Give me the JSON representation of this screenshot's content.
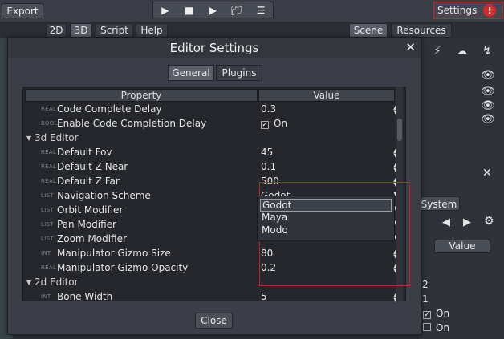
{
  "topbar": {
    "export_label": "Export",
    "settings_label": "Settings",
    "warning_glyph": "!"
  },
  "view_tabs": [
    "2D",
    "3D",
    "Script",
    "Help"
  ],
  "dock_tabs": [
    "Scene",
    "Resources"
  ],
  "right_panel": {
    "system_tab": "System",
    "value_header": "Value",
    "values": [
      "2",
      "1"
    ],
    "checks": [
      "On",
      "On"
    ]
  },
  "dialog": {
    "title": "Editor Settings",
    "tabs": [
      "General",
      "Plugins"
    ],
    "columns": {
      "property": "Property",
      "value": "Value"
    },
    "rows": [
      {
        "kind": "prop",
        "type": "REAL",
        "label": "Code Complete Delay",
        "value": "0.3",
        "control": "spin"
      },
      {
        "kind": "prop",
        "type": "BOOL",
        "label": "Enable Code Completion Delay",
        "value": "On",
        "control": "check"
      },
      {
        "kind": "section",
        "label": "3d Editor"
      },
      {
        "kind": "prop",
        "type": "REAL",
        "label": "Default Fov",
        "value": "45",
        "control": "spin"
      },
      {
        "kind": "prop",
        "type": "REAL",
        "label": "Default Z Near",
        "value": "0.1",
        "control": "spin"
      },
      {
        "kind": "prop",
        "type": "REAL",
        "label": "Default Z Far",
        "value": "500",
        "control": "spin"
      },
      {
        "kind": "prop",
        "type": "LIST",
        "label": "Navigation Scheme",
        "value": "Godot",
        "control": "dropdown"
      },
      {
        "kind": "prop",
        "type": "LIST",
        "label": "Orbit Modifier",
        "value": "",
        "control": "dropdown"
      },
      {
        "kind": "prop",
        "type": "LIST",
        "label": "Pan Modifier",
        "value": "",
        "control": "dropdown"
      },
      {
        "kind": "prop",
        "type": "LIST",
        "label": "Zoom Modifier",
        "value": "",
        "control": "dropdown"
      },
      {
        "kind": "prop",
        "type": "INT",
        "label": "Manipulator Gizmo Size",
        "value": "80",
        "control": "spin"
      },
      {
        "kind": "prop",
        "type": "REAL",
        "label": "Manipulator Gizmo Opacity",
        "value": "0.2",
        "control": "spin"
      },
      {
        "kind": "section",
        "label": "2d Editor"
      },
      {
        "kind": "prop",
        "type": "INT",
        "label": "Bone Width",
        "value": "5",
        "control": "spin"
      }
    ],
    "dropdown_options": [
      "Godot",
      "Maya",
      "Modo"
    ],
    "dropdown_selected": "Godot",
    "close_label": "Close"
  },
  "colors": {
    "highlight_border": "#cc2222",
    "panel_bg": "#3b3e46"
  }
}
